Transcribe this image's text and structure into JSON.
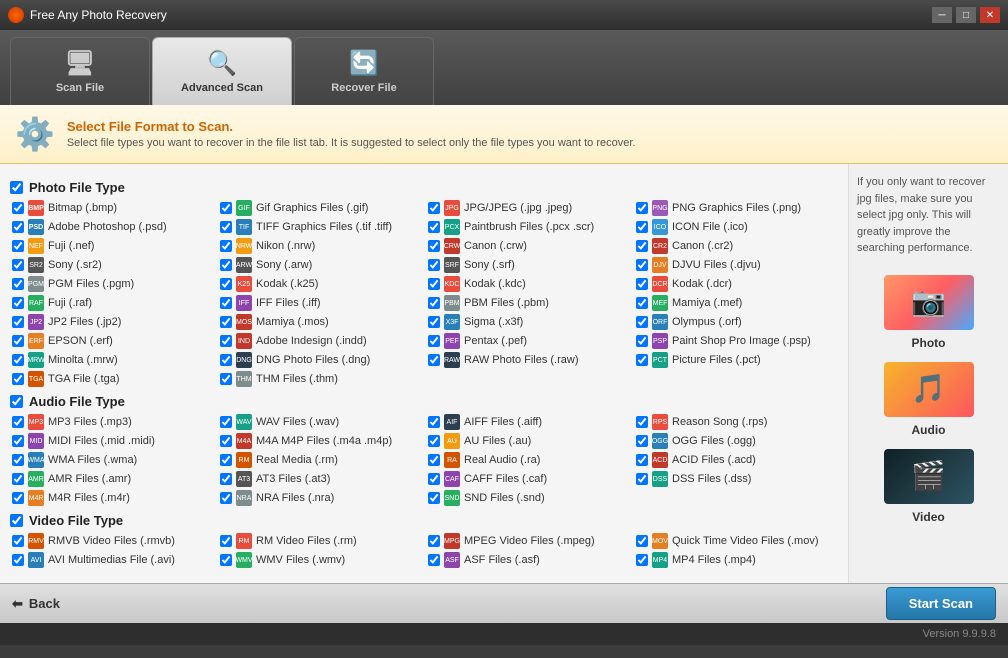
{
  "app": {
    "title": "Free Any Photo Recovery",
    "version": "Version 9.9.9.8"
  },
  "tabs": [
    {
      "id": "scan-file",
      "label": "Scan File",
      "icon": "🖥",
      "active": false
    },
    {
      "id": "advanced-scan",
      "label": "Advanced Scan",
      "icon": "🔍",
      "active": true
    },
    {
      "id": "recover-file",
      "label": "Recover File",
      "icon": "🔄",
      "active": false
    }
  ],
  "banner": {
    "title": "Select File Format to Scan.",
    "description": "Select file types you want to recover in the file list tab. It is suggested to select only the file types you want to recover."
  },
  "sidebar_tip": "If you only want to recover jpg files, make sure you select jpg only. This will greatly improve the searching performance.",
  "categories": [
    {
      "id": "photo",
      "label": "Photo"
    },
    {
      "id": "audio",
      "label": "Audio"
    },
    {
      "id": "video",
      "label": "Video"
    }
  ],
  "photo_section": {
    "header": "Photo File Type",
    "items": [
      {
        "label": "Bitmap (.bmp)",
        "checked": true,
        "ico": "bmp"
      },
      {
        "label": "Gif Graphics Files (.gif)",
        "checked": true,
        "ico": "gif"
      },
      {
        "label": "JPG/JPEG (.jpg .jpeg)",
        "checked": true,
        "ico": "jpg"
      },
      {
        "label": "PNG Graphics Files (.png)",
        "checked": true,
        "ico": "png"
      },
      {
        "label": "Adobe Photoshop (.psd)",
        "checked": true,
        "ico": "psd"
      },
      {
        "label": "TIFF Graphics Files (.tif .tiff)",
        "checked": true,
        "ico": "tiff"
      },
      {
        "label": "Paintbrush Files (.pcx .scr)",
        "checked": true,
        "ico": "pcx"
      },
      {
        "label": "ICON File (.ico)",
        "checked": true,
        "ico": "ico"
      },
      {
        "label": "Fuji (.nef)",
        "checked": true,
        "ico": "nef"
      },
      {
        "label": "Nikon (.nrw)",
        "checked": true,
        "ico": "nrw"
      },
      {
        "label": "Canon (.crw)",
        "checked": true,
        "ico": "crw"
      },
      {
        "label": "Canon (.cr2)",
        "checked": true,
        "ico": "cr2"
      },
      {
        "label": "Sony (.sr2)",
        "checked": true,
        "ico": "sony"
      },
      {
        "label": "Sony (.arw)",
        "checked": true,
        "ico": "arw"
      },
      {
        "label": "Sony (.srf)",
        "checked": true,
        "ico": "srf"
      },
      {
        "label": "DJVU Files (.djvu)",
        "checked": true,
        "ico": "djvu"
      },
      {
        "label": "PGM Files (.pgm)",
        "checked": true,
        "ico": "pgm"
      },
      {
        "label": "Kodak (.k25)",
        "checked": true,
        "ico": "k25"
      },
      {
        "label": "Kodak (.kdc)",
        "checked": true,
        "ico": "kdc"
      },
      {
        "label": "Kodak (.dcr)",
        "checked": true,
        "ico": "dcr"
      },
      {
        "label": "Fuji (.raf)",
        "checked": true,
        "ico": "fuji"
      },
      {
        "label": "IFF Files (.iff)",
        "checked": true,
        "ico": "iff"
      },
      {
        "label": "PBM Files (.pbm)",
        "checked": true,
        "ico": "pbm"
      },
      {
        "label": "Mamiya (.mef)",
        "checked": true,
        "ico": "mef"
      },
      {
        "label": "JP2 Files (.jp2)",
        "checked": true,
        "ico": "jp2"
      },
      {
        "label": "Mamiya (.mos)",
        "checked": true,
        "ico": "mos"
      },
      {
        "label": "Sigma (.x3f)",
        "checked": true,
        "ico": "x3f"
      },
      {
        "label": "Olympus (.orf)",
        "checked": true,
        "ico": "orf"
      },
      {
        "label": "EPSON (.erf)",
        "checked": true,
        "ico": "erf"
      },
      {
        "label": "Adobe Indesign (.indd)",
        "checked": true,
        "ico": "indd"
      },
      {
        "label": "Pentax (.pef)",
        "checked": true,
        "ico": "pef"
      },
      {
        "label": "Paint Shop Pro Image (.psp)",
        "checked": true,
        "ico": "psp"
      },
      {
        "label": "Minolta (.mrw)",
        "checked": true,
        "ico": "mrw"
      },
      {
        "label": "DNG Photo Files (.dng)",
        "checked": true,
        "ico": "dng"
      },
      {
        "label": "RAW Photo Files (.raw)",
        "checked": true,
        "ico": "raw"
      },
      {
        "label": "Picture Files (.pct)",
        "checked": true,
        "ico": "pct"
      },
      {
        "label": "TGA File (.tga)",
        "checked": true,
        "ico": "tga"
      },
      {
        "label": "THM Files (.thm)",
        "checked": true,
        "ico": "thm"
      }
    ]
  },
  "audio_section": {
    "header": "Audio File Type",
    "items": [
      {
        "label": "MP3 Files (.mp3)",
        "checked": true,
        "ico": "mp3"
      },
      {
        "label": "WAV Files (.wav)",
        "checked": true,
        "ico": "wav"
      },
      {
        "label": "AIFF Files (.aiff)",
        "checked": true,
        "ico": "aiff"
      },
      {
        "label": "Reason Song (.rps)",
        "checked": true,
        "ico": "rps"
      },
      {
        "label": "MIDI Files (.mid .midi)",
        "checked": true,
        "ico": "midi"
      },
      {
        "label": "M4A M4P Files (.m4a .m4p)",
        "checked": true,
        "ico": "m4a"
      },
      {
        "label": "AU Files (.au)",
        "checked": true,
        "ico": "au"
      },
      {
        "label": "OGG Files (.ogg)",
        "checked": true,
        "ico": "ogg"
      },
      {
        "label": "WMA Files (.wma)",
        "checked": true,
        "ico": "wma"
      },
      {
        "label": "Real Media (.rm)",
        "checked": true,
        "ico": "rm"
      },
      {
        "label": "Real Audio (.ra)",
        "checked": true,
        "ico": "ra"
      },
      {
        "label": "ACID Files (.acd)",
        "checked": true,
        "ico": "acd"
      },
      {
        "label": "AMR Files (.amr)",
        "checked": true,
        "ico": "amr"
      },
      {
        "label": "AT3 Files (.at3)",
        "checked": true,
        "ico": "at3"
      },
      {
        "label": "CAFF Files (.caf)",
        "checked": true,
        "ico": "caf"
      },
      {
        "label": "DSS Files (.dss)",
        "checked": true,
        "ico": "dss"
      },
      {
        "label": "M4R Files (.m4r)",
        "checked": true,
        "ico": "m4r"
      },
      {
        "label": "NRA Files (.nra)",
        "checked": true,
        "ico": "nra"
      },
      {
        "label": "SND Files (.snd)",
        "checked": true,
        "ico": "snd"
      }
    ]
  },
  "video_section": {
    "header": "Video File Type",
    "items": [
      {
        "label": "RMVB Video Files (.rmvb)",
        "checked": true,
        "ico": "rmvb"
      },
      {
        "label": "RM Video Files (.rm)",
        "checked": true,
        "ico": "rmv"
      },
      {
        "label": "MPEG Video Files (.mpeg)",
        "checked": true,
        "ico": "mpeg"
      },
      {
        "label": "Quick Time Video Files (.mov)",
        "checked": true,
        "ico": "mov"
      },
      {
        "label": "AVI Multimedias File (.avi)",
        "checked": true,
        "ico": "avi"
      },
      {
        "label": "WMV Files (.wmv)",
        "checked": true,
        "ico": "wmv"
      },
      {
        "label": "ASF Files (.asf)",
        "checked": true,
        "ico": "asf"
      },
      {
        "label": "MP4 Files (.mp4)",
        "checked": true,
        "ico": "mp4"
      }
    ]
  },
  "footer": {
    "back_label": "Back",
    "start_scan_label": "Start Scan"
  }
}
